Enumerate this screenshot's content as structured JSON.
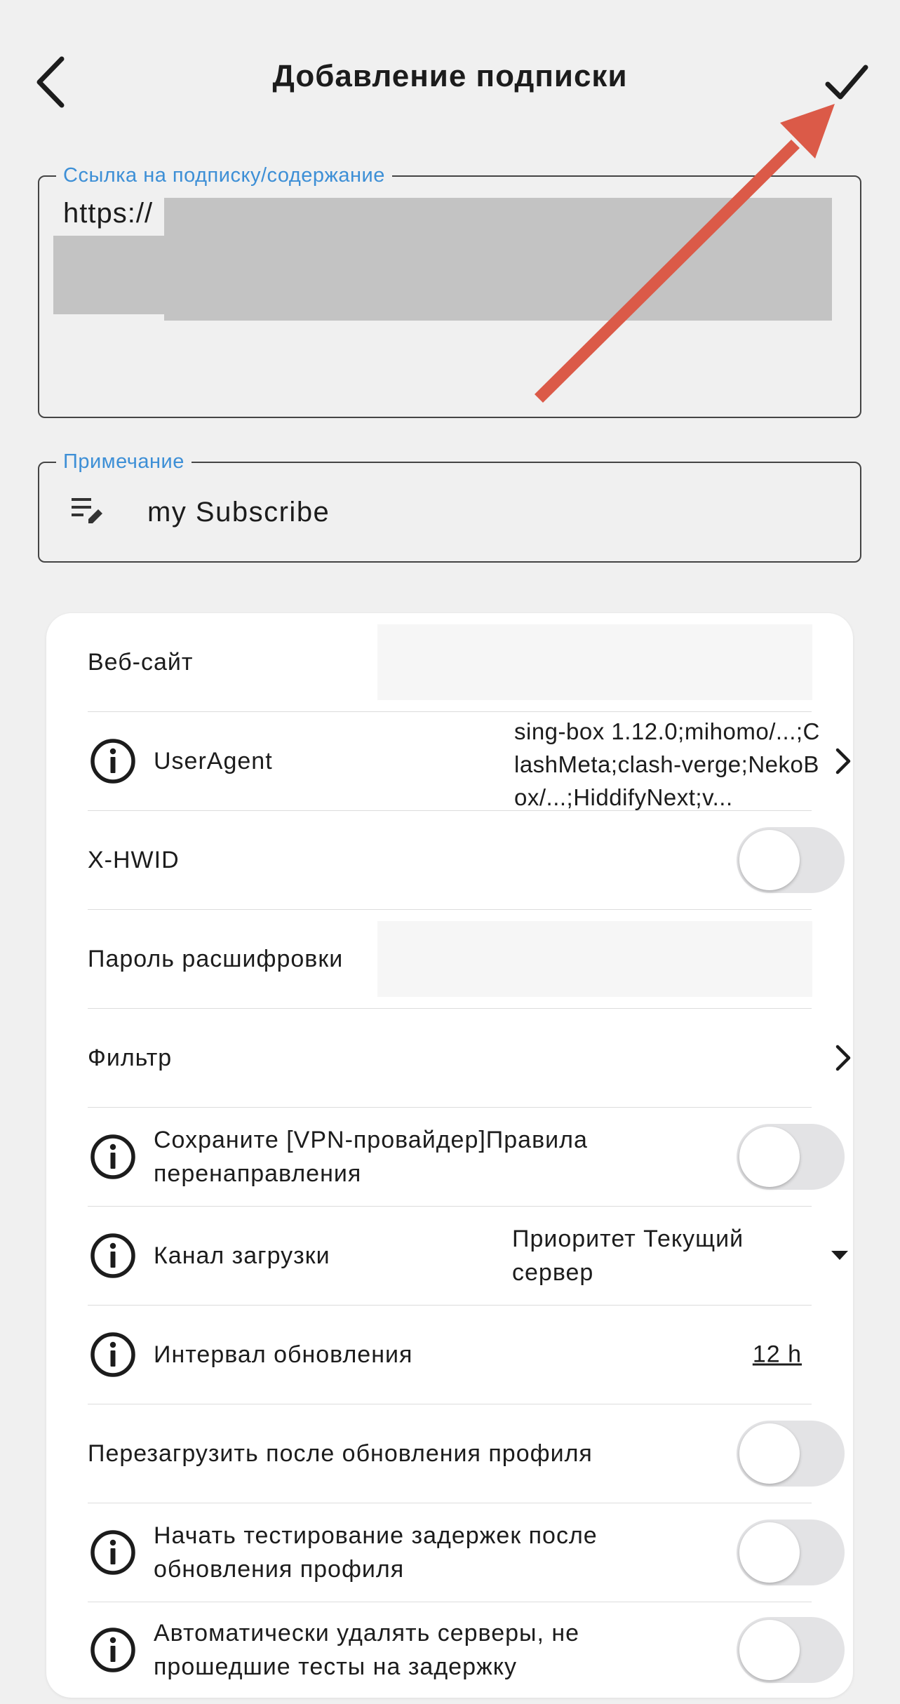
{
  "header": {
    "title": "Добавление подписки",
    "back_icon": "chevron-left-icon",
    "save_icon": "check-icon"
  },
  "url_field": {
    "label": "Ссылка на подписку/содержание",
    "value": "https://"
  },
  "note_field": {
    "label": "Примечание",
    "icon": "notes-edit-icon",
    "value": "my Subscribe"
  },
  "settings": {
    "website": {
      "label": "Веб-сайт",
      "value": ""
    },
    "user_agent": {
      "label": "UserAgent",
      "value": "sing-box 1.12.0;mihomo/...;ClashMeta;clash-verge;NekoBox/...;HiddifyNext;v..."
    },
    "hwid": {
      "label": "X-HWID",
      "enabled": false
    },
    "decrypt_password": {
      "label": "Пароль расшифровки",
      "value": ""
    },
    "filter": {
      "label": "Фильтр"
    },
    "keep_rules": {
      "label": "Сохраните [VPN-провайдер]Правила перенаправления",
      "enabled": false
    },
    "download_channel": {
      "label": "Канал загрузки",
      "value": "Приоритет Текущий сервер"
    },
    "update_interval": {
      "label": "Интервал обновления",
      "value": "12 h"
    },
    "reload_after_update": {
      "label": "Перезагрузить после обновления профиля",
      "enabled": false
    },
    "latency_test_after_update": {
      "label": "Начать тестирование задержек после обновления профиля",
      "enabled": false
    },
    "auto_remove_failed": {
      "label": "Автоматически удалять серверы, не прошедшие тесты на задержку",
      "enabled": false
    }
  },
  "colors": {
    "background": "#f0f0f0",
    "field_label": "#3d8fd6",
    "annotation_arrow": "#db5a48",
    "toggle_off": "#e3e3e5",
    "redaction": "#c3c3c3"
  }
}
